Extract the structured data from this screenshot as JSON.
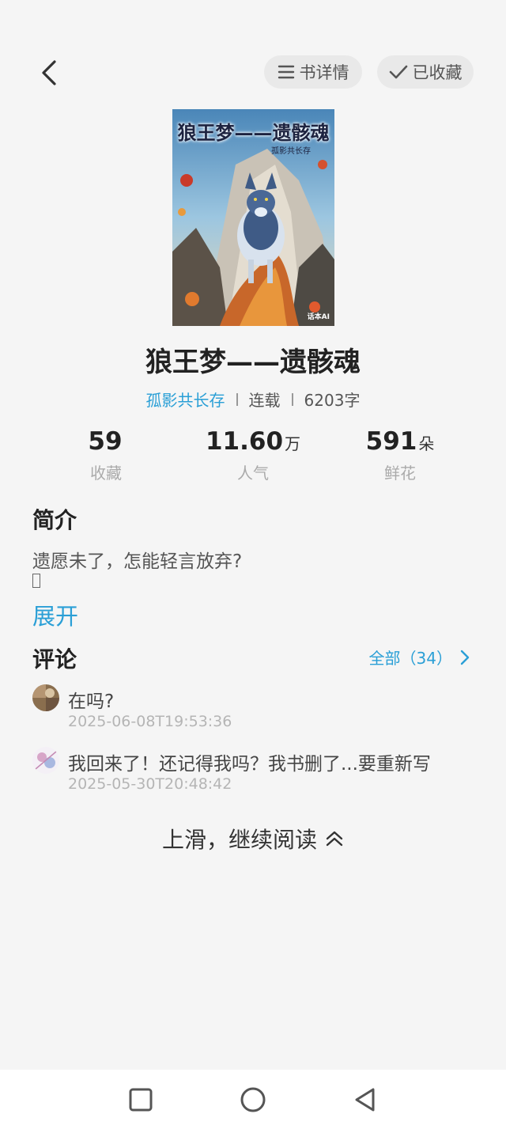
{
  "header": {
    "back_icon": "chevron-left-icon",
    "details_label": "书详情",
    "details_icon": "menu-lines-icon",
    "favorite_label": "已收藏",
    "favorite_icon": "checkmark-icon"
  },
  "book": {
    "cover": {
      "title": "狼王梦——遗骸魂",
      "author": "孤影共长存",
      "publisher_mark": "话本AI"
    },
    "title": "狼王梦——遗骸魂",
    "author": "孤影共长存",
    "status": "连载",
    "word_count": "6203字"
  },
  "stats": [
    {
      "value": "59",
      "unit": "",
      "label": "收藏"
    },
    {
      "value": "11.60",
      "unit": "万",
      "label": "人气"
    },
    {
      "value": "591",
      "unit": "朵",
      "label": "鲜花"
    }
  ],
  "intro": {
    "heading": "简介",
    "text": "遗愿未了，怎能轻言放弃?",
    "expand_label": "展开"
  },
  "comments": {
    "heading": "评论",
    "all_label": "全部（34）",
    "items": [
      {
        "text": "在吗?",
        "time": "2025-06-08T19:53:36"
      },
      {
        "text": "我回来了！还记得我吗？我书删了...要重新写",
        "time": "2025-05-30T20:48:42"
      }
    ]
  },
  "footer": {
    "swipe_hint": "上滑，继续阅读"
  },
  "colors": {
    "accent": "#2a9fd6",
    "background": "#f5f5f5",
    "pill_background": "#e9e9e9"
  }
}
